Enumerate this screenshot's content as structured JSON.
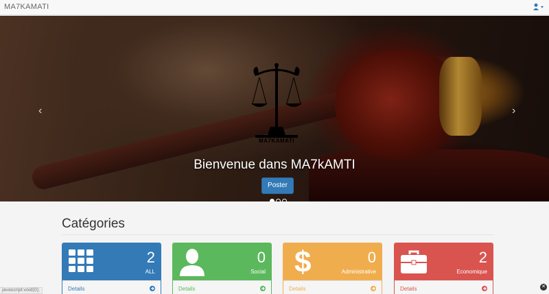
{
  "navbar": {
    "brand": "MA7KAMATI",
    "user_icon": "user-icon"
  },
  "carousel": {
    "logo_text": "MA7KAMATI",
    "caption": "Bienvenue dans MA7kAMTI",
    "button_label": "Poster",
    "prev_glyph": "‹",
    "next_glyph": "›",
    "slides": 3,
    "active_slide": 1
  },
  "categories": {
    "title": "Catégories",
    "cards": [
      {
        "count": "2",
        "label": "ALL",
        "details": "Details",
        "icon": "grid-icon",
        "color": "#337ab7"
      },
      {
        "count": "0",
        "label": "Social",
        "details": "Details",
        "icon": "person-icon",
        "color": "#5cb85c"
      },
      {
        "count": "0",
        "label": "Administrative",
        "details": "Details",
        "icon": "dollar-icon",
        "color": "#f0ad4e"
      },
      {
        "count": "2",
        "label": "Economique",
        "details": "Details",
        "icon": "briefcase-icon",
        "color": "#d9534f"
      }
    ]
  },
  "status_bar": {
    "url": "javascript:void(0);"
  }
}
